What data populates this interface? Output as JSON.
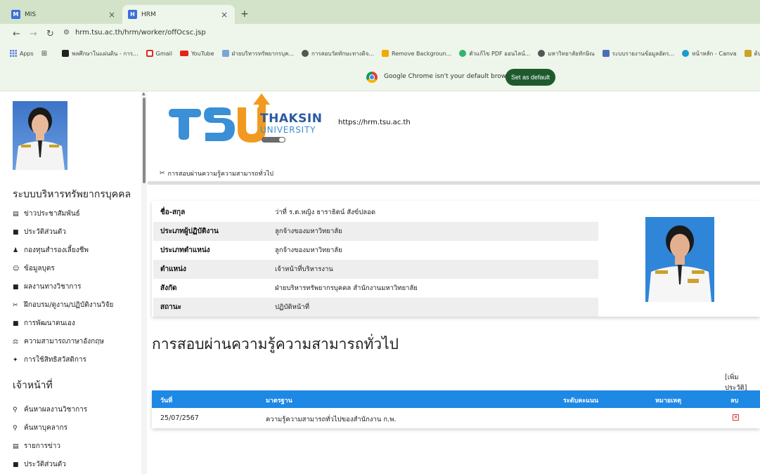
{
  "browser": {
    "tabs": [
      {
        "label": "MIS",
        "favicon": "M"
      },
      {
        "label": "HRM",
        "favicon": "H"
      }
    ],
    "new_tab": "+",
    "close_glyph": "×",
    "url": "hrm.tsu.ac.th/hrm/worker/offOcsc.jsp",
    "bookmarks": [
      {
        "label": "Apps",
        "icon": "apps-grid-icon"
      },
      {
        "label": "พลศึกษาในแผ่นดิน - การ...",
        "icon": "k-icon",
        "color": "#222222"
      },
      {
        "label": "Gmail",
        "icon": "gmail-icon",
        "color": "#d93025"
      },
      {
        "label": "YouTube",
        "icon": "youtube-icon",
        "color": "#e62117"
      },
      {
        "label": "ฝ่ายบริหารทรัพยากรบุค...",
        "icon": "tsu-icon",
        "color": "#7aa6d6"
      },
      {
        "label": "การสอบวัดทักษะทางดิจ...",
        "icon": "globe-icon",
        "color": "#555555"
      },
      {
        "label": "Remove Backgroun...",
        "icon": "removebg-icon",
        "color": "#f2a900"
      },
      {
        "label": "ตัวแก้ไข PDF ออนไลน์...",
        "icon": "pdf-icon",
        "color": "#31b46c"
      },
      {
        "label": "มหาวิทยาลัยทักษิณ",
        "icon": "globe-icon",
        "color": "#555555"
      },
      {
        "label": "ระบบรายงานข้อมูลอัตร...",
        "icon": "report-icon",
        "color": "#4a6fb5"
      },
      {
        "label": "หน้าหลัก - Canva",
        "icon": "canva-icon",
        "color": "#1b9ad1"
      },
      {
        "label": "ต้นทางการกิจจานุเบกษา",
        "icon": "gazette-icon",
        "color": "#c9a227"
      }
    ],
    "default_browser_msg": "Google Chrome isn't your default browser",
    "set_default_label": "Set as default"
  },
  "sidebar": {
    "title": "ระบบบริหารทรัพยากรบุคคล",
    "items": [
      {
        "label": "ข่าวประชาสัมพันธ์",
        "icon": "news-icon"
      },
      {
        "label": "ประวัติส่วนตัว",
        "icon": "book-icon"
      },
      {
        "label": "กองทุนสำรองเลี้ยงชีพ",
        "icon": "money-bag-icon"
      },
      {
        "label": "ข้อมูลบุตร",
        "icon": "child-icon"
      },
      {
        "label": "ผลงานทางวิชาการ",
        "icon": "book-icon"
      },
      {
        "label": "ฝึกอบรม/ดูงาน/ปฏิบัติงานวิจัย",
        "icon": "tools-icon"
      },
      {
        "label": "การพัฒนาตนเอง",
        "icon": "book-icon"
      },
      {
        "label": "ความสามารถภาษาอังกฤษ",
        "icon": "language-icon"
      },
      {
        "label": "การใช้สิทธิสวัสดิการ",
        "icon": "star-icon"
      }
    ],
    "officer_title": "เจ้าหน้าที่",
    "officer_items": [
      {
        "label": "ค้นหาผลงานวิชาการ",
        "icon": "search-icon"
      },
      {
        "label": "ค้นหาบุคลากร",
        "icon": "search-icon"
      },
      {
        "label": "รายการข่าว",
        "icon": "news-icon"
      },
      {
        "label": "ประวัติส่วนตัว",
        "icon": "book-icon"
      }
    ]
  },
  "header": {
    "logo_text_1": "THAKSIN",
    "logo_text_2": "UNIVERSITY",
    "site_url": "https://hrm.tsu.ac.th",
    "breadcrumb": "การสอบผ่านความรู้ความสามารถทั่วไป"
  },
  "employee": {
    "rows": [
      {
        "key": "ชื่อ-สกุล",
        "value": "ว่าที่ ร.ต.หญิง ธาราธิตน์ สังข์ปลอด"
      },
      {
        "key": "ประเภทผู้ปฏิบัติงาน",
        "value": "ลูกจ้างของมหาวิทยาลัย"
      },
      {
        "key": "ประเภทตำแหน่ง",
        "value": "ลูกจ้างของมหาวิทยาลัย"
      },
      {
        "key": "ตำแหน่ง",
        "value": "เจ้าหน้าที่บริหารงาน"
      },
      {
        "key": "สังกัด",
        "value": "ฝ่ายบริหารทรัพยากรบุคคล สำนักงานมหาวิทยาลัย"
      },
      {
        "key": "สถานะ",
        "value": "ปฏิบัติหน้าที่"
      }
    ]
  },
  "section": {
    "heading": "การสอบผ่านความรู้ความสามารถทั่วไป",
    "add_link": "[เพิ่มประวัติ]"
  },
  "table": {
    "headers": [
      "วันที่",
      "มาตรฐาน",
      "ระดับคะแนน",
      "หมายเหตุ",
      "ลบ"
    ],
    "rows": [
      {
        "date": "25/07/2567",
        "standard": "ความรู้ความสามารถทั่วไปของสำนักงาน ก.พ.",
        "score": "",
        "note": "",
        "delete": "×"
      }
    ]
  }
}
